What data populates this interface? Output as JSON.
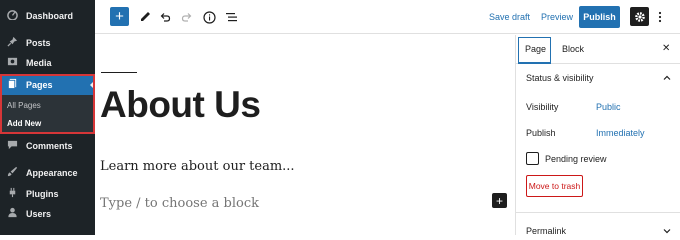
{
  "admin_menu": {
    "items": [
      {
        "label": "Dashboard",
        "icon": "dashboard-icon"
      },
      {
        "label": "Posts",
        "icon": "pin-icon"
      },
      {
        "label": "Media",
        "icon": "media-icon"
      },
      {
        "label": "Pages",
        "icon": "pages-icon"
      },
      {
        "label": "Comments",
        "icon": "comments-icon"
      },
      {
        "label": "Appearance",
        "icon": "brush-icon"
      },
      {
        "label": "Plugins",
        "icon": "plugin-icon"
      },
      {
        "label": "Users",
        "icon": "users-icon"
      }
    ],
    "submenu": [
      "All Pages",
      "Add New"
    ],
    "accent_color": "#2271b1",
    "highlight_color": "#d63638"
  },
  "toolbar": {
    "save_draft": "Save draft",
    "preview": "Preview",
    "publish": "Publish"
  },
  "editor": {
    "title": "About Us",
    "paragraph": "Learn more about our team...",
    "placeholder": "Type / to choose a block"
  },
  "sidebar": {
    "tabs": [
      "Page",
      "Block"
    ],
    "status_panel": {
      "title": "Status & visibility",
      "visibility_label": "Visibility",
      "visibility_value": "Public",
      "publish_label": "Publish",
      "publish_value": "Immediately",
      "pending_review": "Pending review",
      "move_to_trash": "Move to trash"
    },
    "permalink_panel": {
      "title": "Permalink"
    }
  }
}
